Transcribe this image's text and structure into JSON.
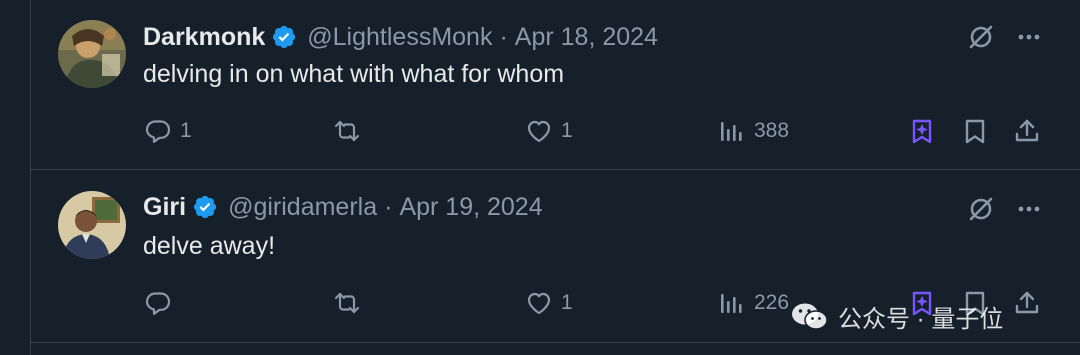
{
  "tweets": [
    {
      "name": "Darkmonk",
      "handle": "@LightlessMonk",
      "separator": "·",
      "date": "Apr 18, 2024",
      "text": "delving in on what with what for whom",
      "replies": "1",
      "retweets": "",
      "likes": "1",
      "views": "388"
    },
    {
      "name": "Giri",
      "handle": "@giridamerla",
      "separator": "·",
      "date": "Apr 19, 2024",
      "text": "delve away!",
      "replies": "",
      "retweets": "",
      "likes": "1",
      "views": "226"
    }
  ],
  "watermark": {
    "text": "公众号 · 量子位"
  },
  "colors": {
    "background": "#15202b",
    "text_primary": "#e7e9ea",
    "text_secondary": "#8b98a5",
    "verified": "#1d9bf0",
    "grok_accent": "#7856ff",
    "divider": "#38444d"
  },
  "icons": [
    "verified-badge-icon",
    "grok-icon",
    "more-icon",
    "reply-icon",
    "retweet-icon",
    "like-icon",
    "views-icon",
    "grok-bookmark-icon",
    "bookmark-icon",
    "share-icon",
    "wechat-icon"
  ]
}
